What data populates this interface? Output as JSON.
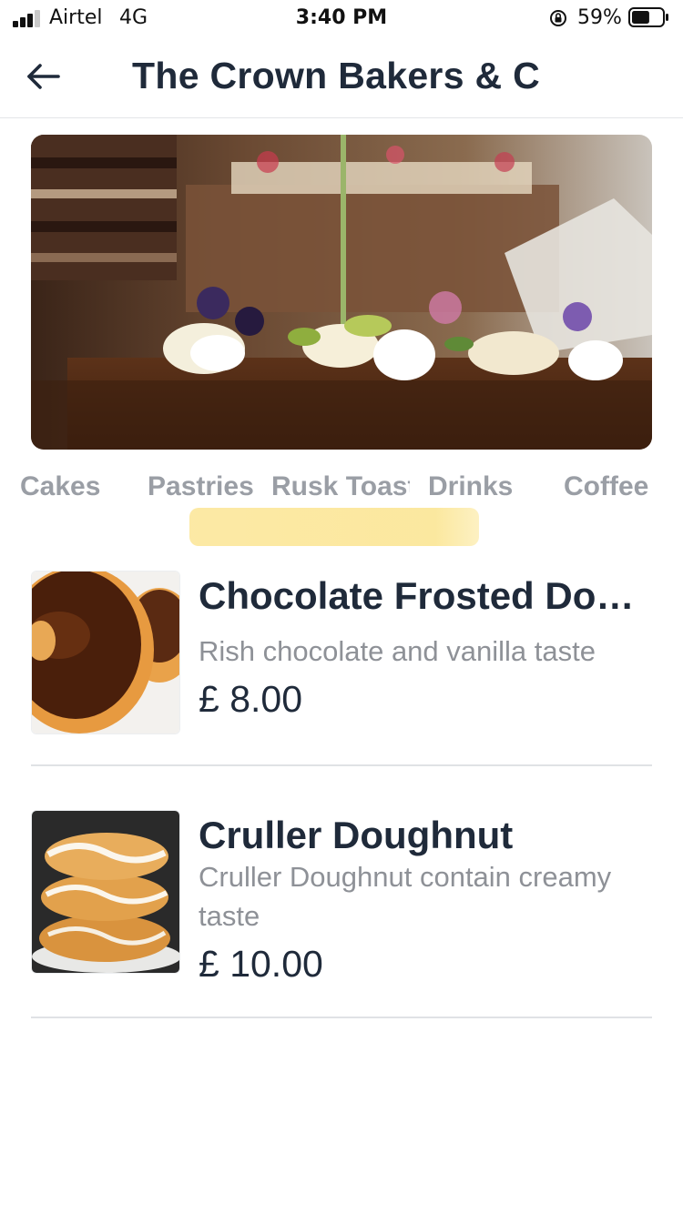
{
  "status_bar": {
    "carrier": "Airtel",
    "network": "4G",
    "time": "3:40 PM",
    "battery_percent": "59%",
    "signal_bars": 3,
    "battery_level": 0.59
  },
  "header": {
    "back_icon": "arrow-left-icon",
    "title": "The Crown Bakers & C"
  },
  "hero": {
    "image": "bakery-cakes-photo"
  },
  "categories": {
    "items": [
      {
        "label": "Cakes"
      },
      {
        "label": "Pastries"
      },
      {
        "label": "Rusk Toast"
      },
      {
        "label": "Drinks"
      },
      {
        "label": "Coffee"
      }
    ],
    "highlight_color": "#fbe79a"
  },
  "products": [
    {
      "name": "Chocolate Frosted Doughnut",
      "description": "Rish chocolate and vanilla taste",
      "price": "£ 8.00",
      "image": "chocolate-doughnut-photo"
    },
    {
      "name": "Cruller Doughnut",
      "description": "Cruller Doughnut contain creamy taste",
      "price": "£ 10.00",
      "image": "cruller-doughnut-photo"
    }
  ],
  "colors": {
    "text_primary": "#1f2a3a",
    "text_secondary": "#8e9197",
    "tab_inactive": "#9a9ea5",
    "divider": "#e0e2e5"
  }
}
